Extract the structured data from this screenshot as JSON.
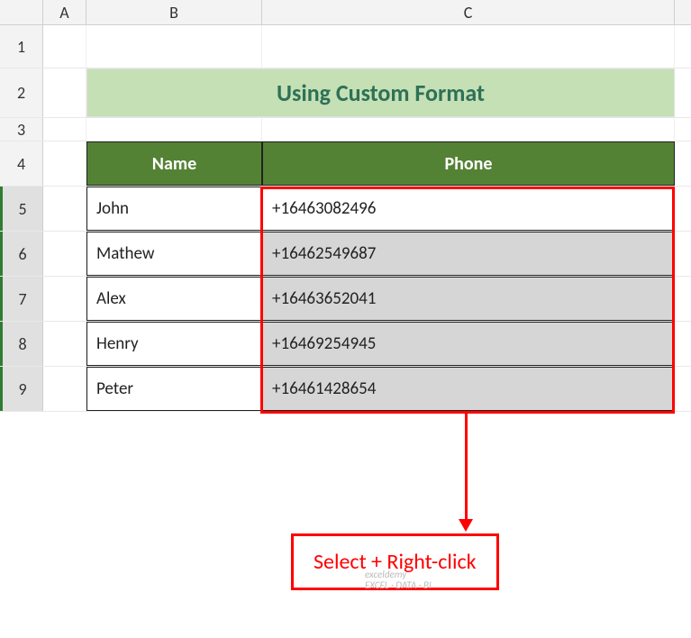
{
  "columns": {
    "A": "A",
    "B": "B",
    "C": "C"
  },
  "rows": {
    "1": "1",
    "2": "2",
    "3": "3",
    "4": "4",
    "5": "5",
    "6": "6",
    "7": "7",
    "8": "8",
    "9": "9"
  },
  "title": "Using Custom Format",
  "headers": {
    "name": "Name",
    "phone": "Phone"
  },
  "data": [
    {
      "name": "John",
      "phone": "+16463082496"
    },
    {
      "name": "Mathew",
      "phone": "+16462549687"
    },
    {
      "name": "Alex",
      "phone": "+16463652041"
    },
    {
      "name": "Henry",
      "phone": "+16469254945"
    },
    {
      "name": "Peter",
      "phone": "+16461428654"
    }
  ],
  "callout": "Select + Right-click",
  "watermark": {
    "line1": "exceldemy",
    "line2": "EXCEL · DATA · BI"
  },
  "chart_data": {
    "type": "table",
    "title": "Using Custom Format",
    "columns": [
      "Name",
      "Phone"
    ],
    "rows": [
      [
        "John",
        "+16463082496"
      ],
      [
        "Mathew",
        "+16462549687"
      ],
      [
        "Alex",
        "+16463652041"
      ],
      [
        "Henry",
        "+16469254945"
      ],
      [
        "Peter",
        "+16461428654"
      ]
    ]
  }
}
